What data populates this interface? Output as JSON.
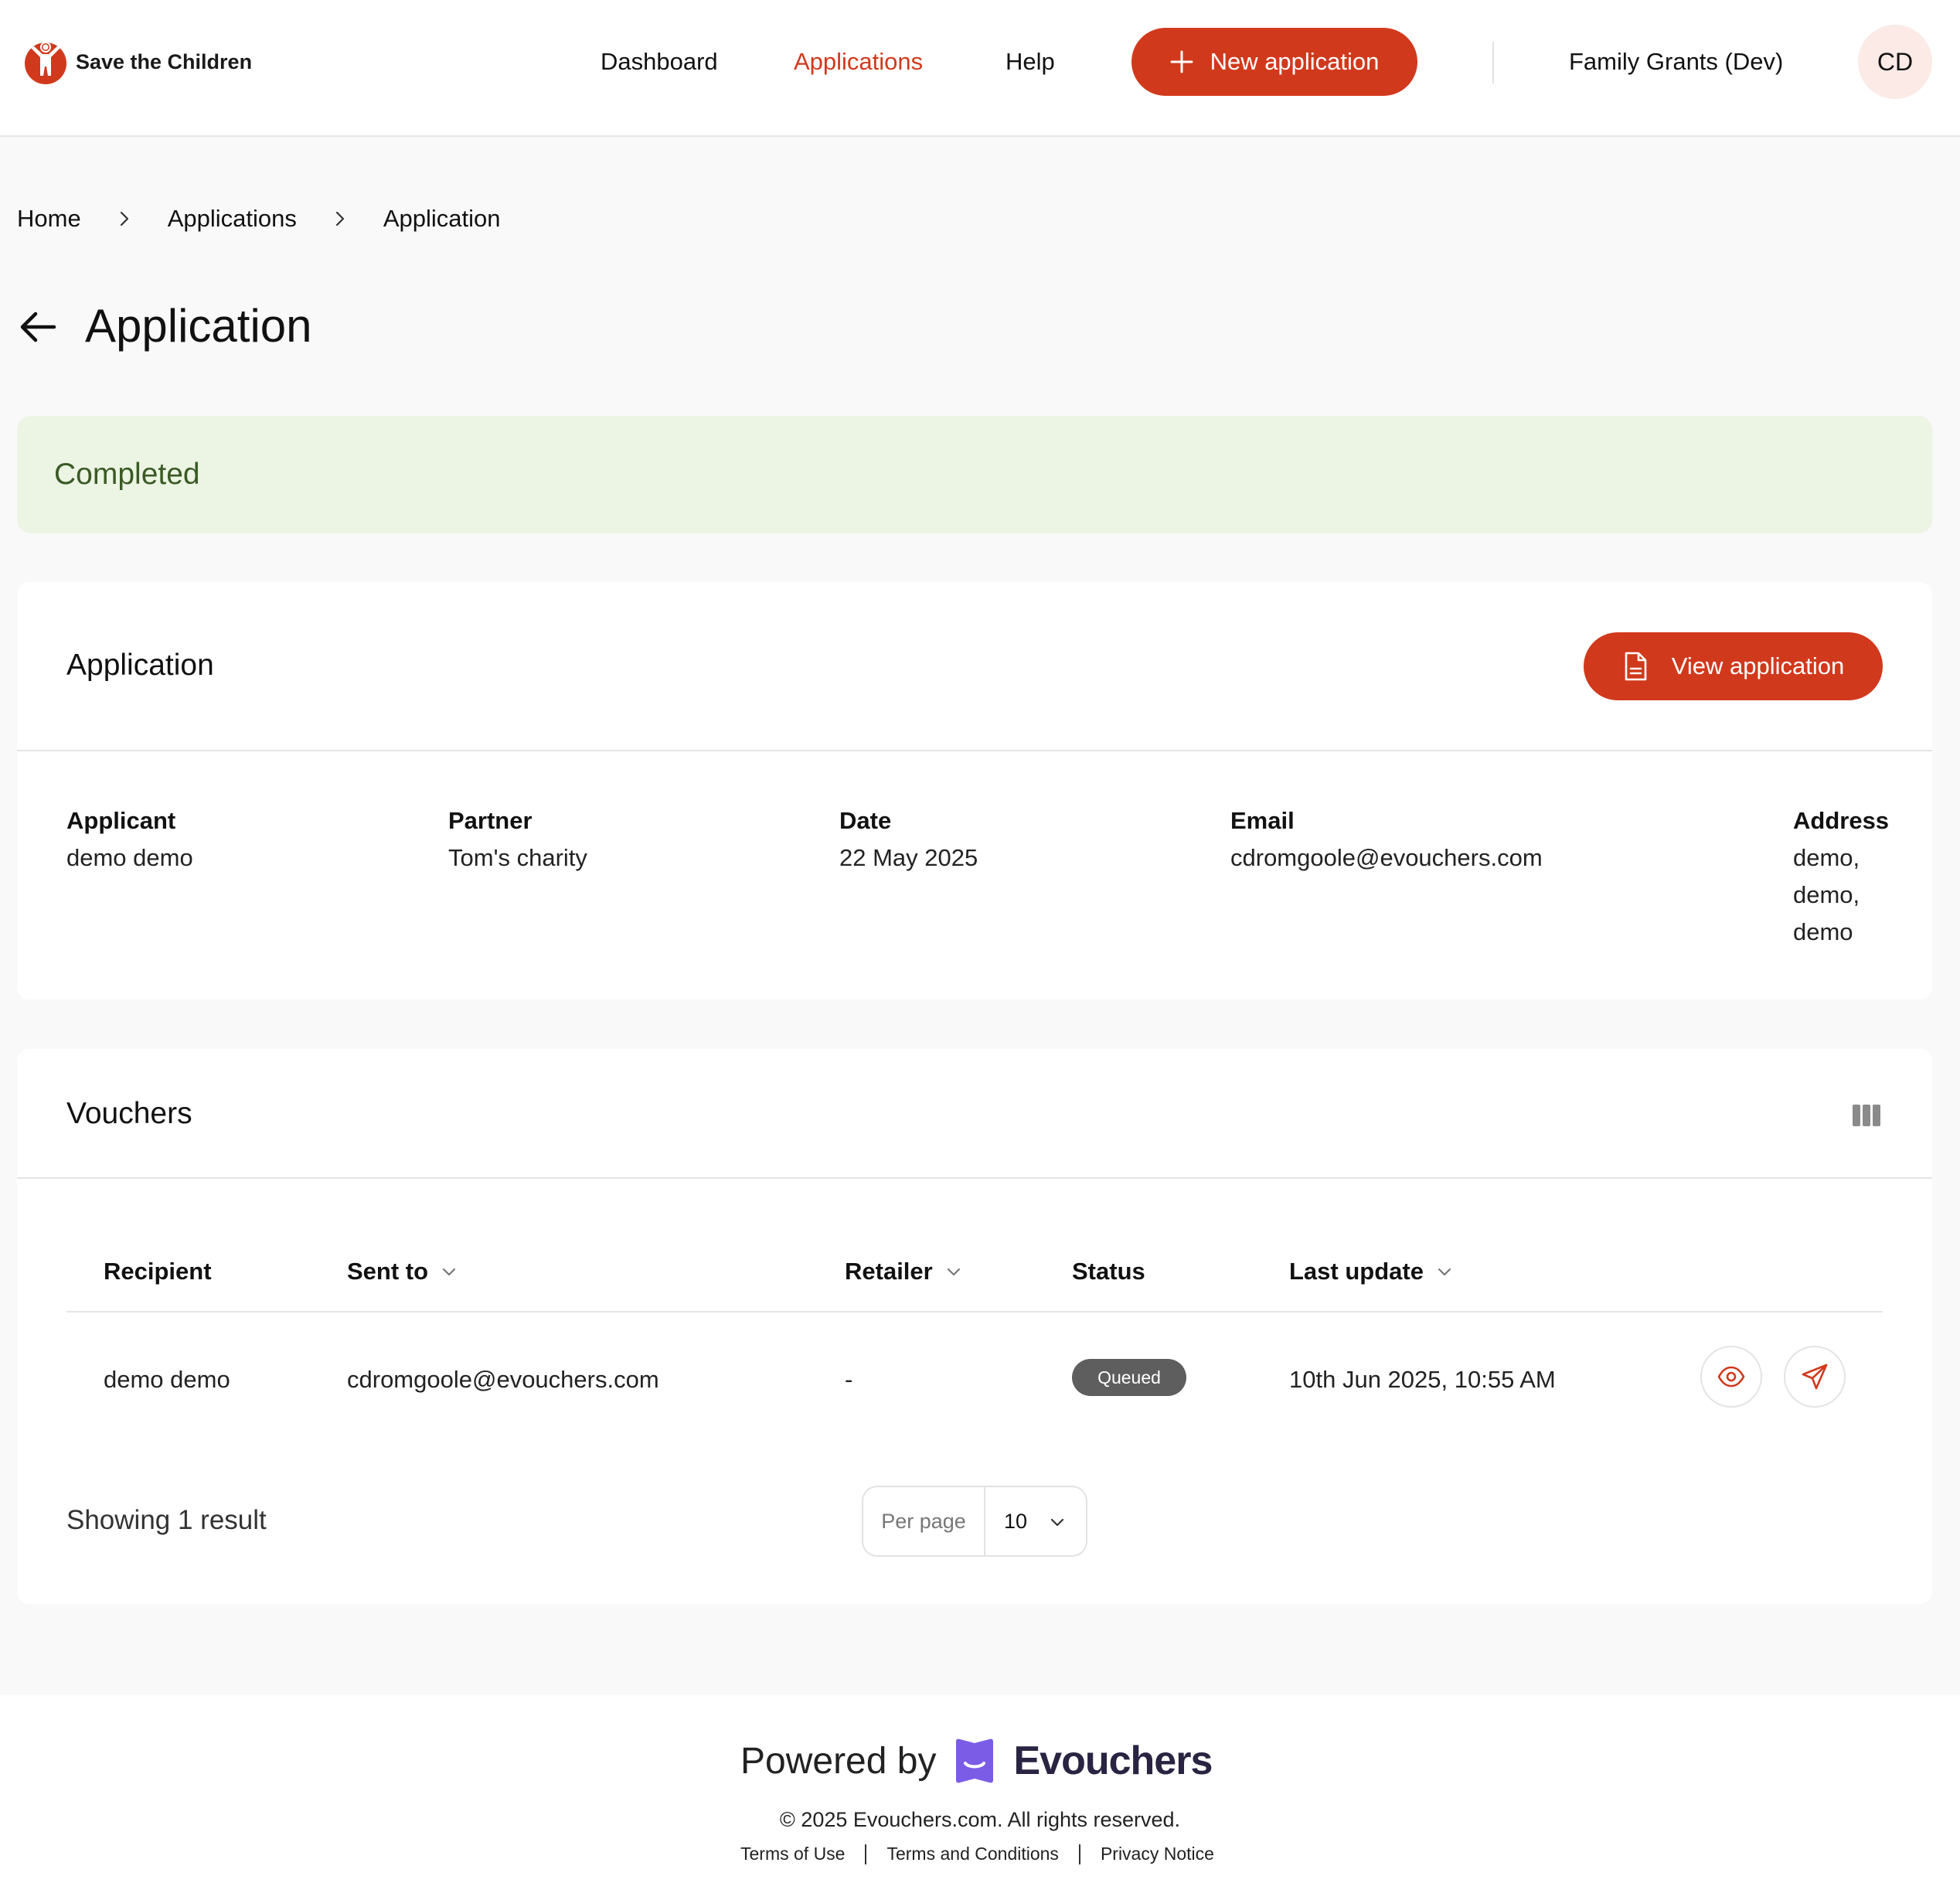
{
  "header": {
    "logo_text": "Save the Children",
    "nav": {
      "dashboard": "Dashboard",
      "applications": "Applications",
      "help": "Help"
    },
    "new_application_label": "New application",
    "org_name": "Family Grants (Dev)",
    "avatar_initials": "CD"
  },
  "breadcrumb": [
    "Home",
    "Applications",
    "Application"
  ],
  "page_title": "Application",
  "status_banner": "Completed",
  "application_card": {
    "title": "Application",
    "view_button_label": "View application",
    "fields": {
      "applicant": {
        "label": "Applicant",
        "value": "demo demo"
      },
      "partner": {
        "label": "Partner",
        "value": "Tom's charity"
      },
      "date": {
        "label": "Date",
        "value": "22 May 2025"
      },
      "email": {
        "label": "Email",
        "value": "cdromgoole@evouchers.com"
      },
      "address": {
        "label": "Address",
        "lines": [
          "demo,",
          "demo,",
          "demo"
        ]
      }
    }
  },
  "vouchers_card": {
    "title": "Vouchers",
    "columns": {
      "recipient": "Recipient",
      "sent_to": "Sent to",
      "retailer": "Retailer",
      "status": "Status",
      "last_update": "Last update"
    },
    "rows": [
      {
        "recipient": "demo demo",
        "sent_to": "cdromgoole@evouchers.com",
        "retailer": "-",
        "status": "Queued",
        "last_update": "10th Jun 2025, 10:55 AM"
      }
    ],
    "showing_text": "Showing 1 result",
    "per_page_label": "Per page",
    "per_page_value": "10"
  },
  "footer": {
    "powered_by": "Powered by",
    "brand": "Evouchers",
    "copyright": "© 2025 Evouchers.com. All rights reserved.",
    "links": [
      "Terms of Use",
      "Terms and Conditions",
      "Privacy Notice"
    ]
  },
  "colors": {
    "accent": "#d1391c",
    "success_bg": "#ecf4e4",
    "success_text": "#3a5a24",
    "badge_bg": "#5e5e5e",
    "brand_purple": "#7b5ce6"
  },
  "icons": {
    "logo": "save-the-children-logo",
    "new_application": "plus-icon",
    "breadcrumb_separator": "chevron-right-icon",
    "back": "arrow-left-icon",
    "view_application": "document-icon",
    "columns": "columns-icon",
    "sort": "chevron-down-icon",
    "view_voucher": "eye-icon",
    "send_voucher": "send-icon"
  }
}
